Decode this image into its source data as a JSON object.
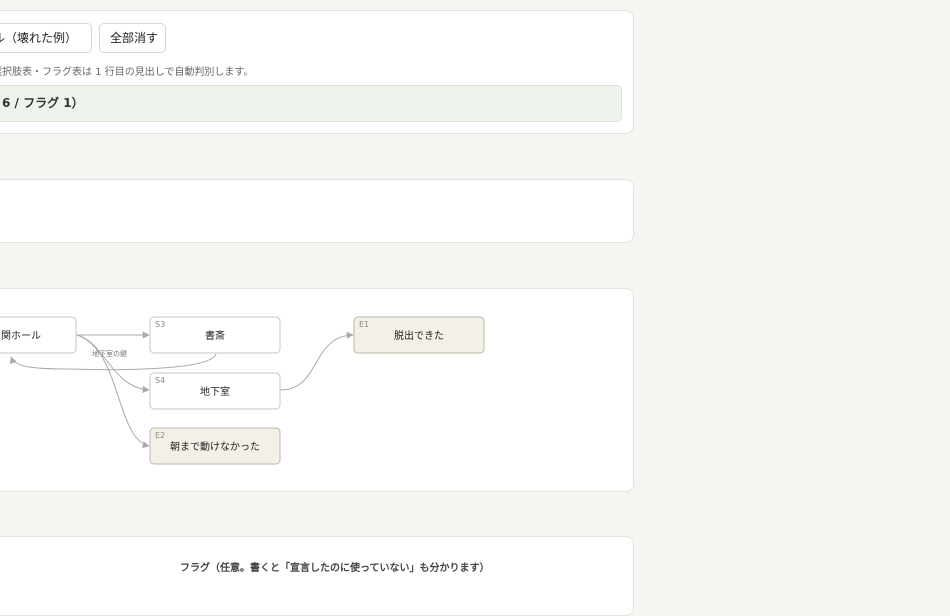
{
  "toolbar": {
    "sample_button": "ル（壊れた例）",
    "clear_button": "全部消す"
  },
  "hint": "選択肢表・フラグ表は 1 行目の見出しで自動判別します。",
  "status": "6 / フラグ 1）",
  "graph": {
    "nodes": [
      {
        "id": "",
        "label": "関ホール",
        "kind": "scene"
      },
      {
        "id": "S3",
        "label": "書斎",
        "kind": "scene"
      },
      {
        "id": "S4",
        "label": "地下室",
        "kind": "scene"
      },
      {
        "id": "E1",
        "label": "脱出できた",
        "kind": "ending"
      },
      {
        "id": "E2",
        "label": "朝まで動けなかった",
        "kind": "ending"
      }
    ],
    "edge_label": "地下室の鍵"
  },
  "flags": {
    "title": "フラグ（任意。書くと「宣言したのに使っていない」も分かります）"
  },
  "colors": {
    "background": "#f6f5f1",
    "status_bg": "#eef3ec",
    "ending_bg": "#f3f0e8",
    "edge": "#a9a9a9"
  }
}
